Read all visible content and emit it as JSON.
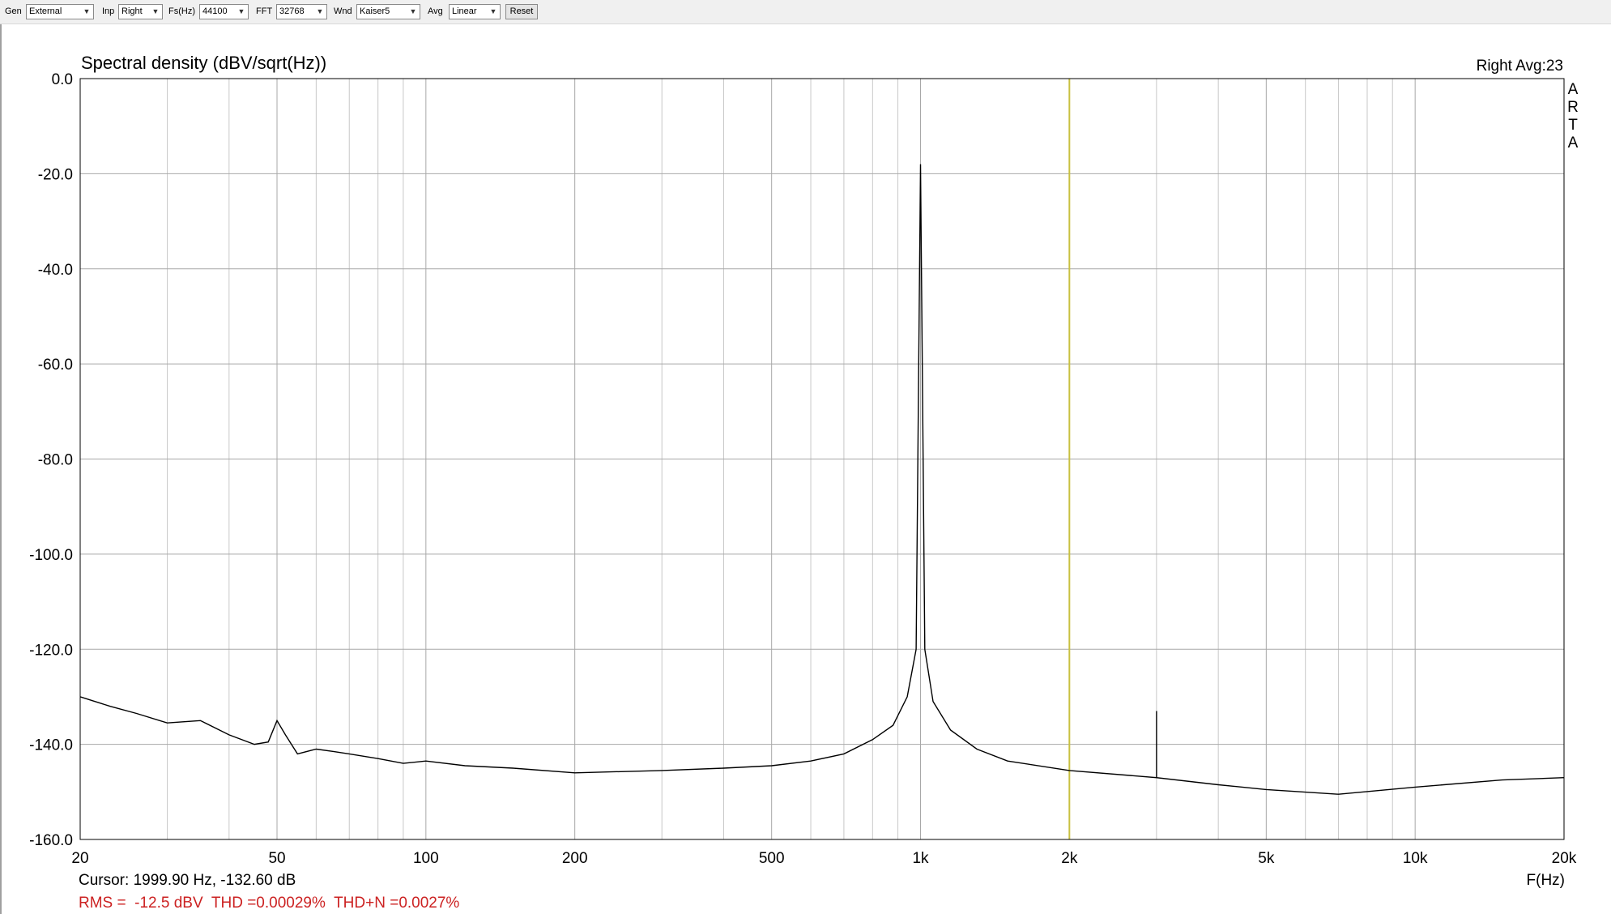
{
  "toolbar": {
    "gen_label": "Gen",
    "gen_value": "External",
    "inp_label": "Inp",
    "inp_value": "Right",
    "fs_label": "Fs(Hz)",
    "fs_value": "44100",
    "fft_label": "FFT",
    "fft_value": "32768",
    "wnd_label": "Wnd",
    "wnd_value": "Kaiser5",
    "avg_label": "Avg",
    "avg_value": "Linear",
    "reset_label": "Reset"
  },
  "plot": {
    "title": "Spectral density (dBV/sqrt(Hz))",
    "channel_info": "Right  Avg:23",
    "brand_letters": [
      "A",
      "R",
      "T",
      "A"
    ],
    "cursor_text": "Cursor: 1999.90 Hz, -132.60 dB",
    "measurements_text": "RMS =  -12.5 dBV  THD =0.00029%  THD+N =0.0027%",
    "colors": {
      "trace": "#000000",
      "grid": "#c8c8c8",
      "cursor": "#c8c040",
      "measurements": "#cc2222",
      "background": "#ffffff"
    }
  },
  "chart_data": {
    "type": "line",
    "title": "Spectral density (dBV/sqrt(Hz))",
    "xlabel": "F(Hz)",
    "ylabel": "",
    "x_scale": "log",
    "xlim": [
      20,
      20000
    ],
    "ylim": [
      -160,
      0
    ],
    "grid": true,
    "x_ticks": [
      20,
      50,
      100,
      200,
      500,
      1000,
      2000,
      5000,
      10000,
      20000
    ],
    "x_tick_labels": [
      "20",
      "50",
      "100",
      "200",
      "500",
      "1k",
      "2k",
      "5k",
      "10k",
      "20k"
    ],
    "y_ticks": [
      0,
      -20,
      -40,
      -60,
      -80,
      -100,
      -120,
      -140,
      -160
    ],
    "y_tick_labels": [
      "0.0",
      "-20.0",
      "-40.0",
      "-60.0",
      "-80.0",
      "-100.0",
      "-120.0",
      "-140.0",
      "-160.0"
    ],
    "cursor_x": 1999.9,
    "series": [
      {
        "x": [
          20,
          23,
          26,
          30,
          35,
          40,
          45,
          48,
          50,
          52,
          55,
          60,
          65,
          70,
          80,
          90,
          100,
          120,
          150,
          200,
          300,
          400,
          500,
          600,
          700,
          800,
          880,
          940,
          980,
          1000,
          1020,
          1060,
          1150,
          1300,
          1500,
          2000,
          3000,
          3000,
          3000,
          4000,
          5000,
          7000,
          10000,
          15000,
          20000
        ],
        "y": [
          -130,
          -132,
          -133.5,
          -135.5,
          -135,
          -138,
          -140,
          -139.5,
          -135,
          -138,
          -142,
          -141,
          -141.5,
          -142,
          -143,
          -144,
          -143.5,
          -144.5,
          -145,
          -146,
          -145.5,
          -145,
          -144.5,
          -143.5,
          -142,
          -139,
          -136,
          -130,
          -120,
          -18,
          -120,
          -131,
          -137,
          -141,
          -143.5,
          -145.5,
          -147,
          -133,
          -147,
          -148.5,
          -149.5,
          -150.5,
          -149,
          -147.5,
          -147
        ]
      }
    ]
  }
}
